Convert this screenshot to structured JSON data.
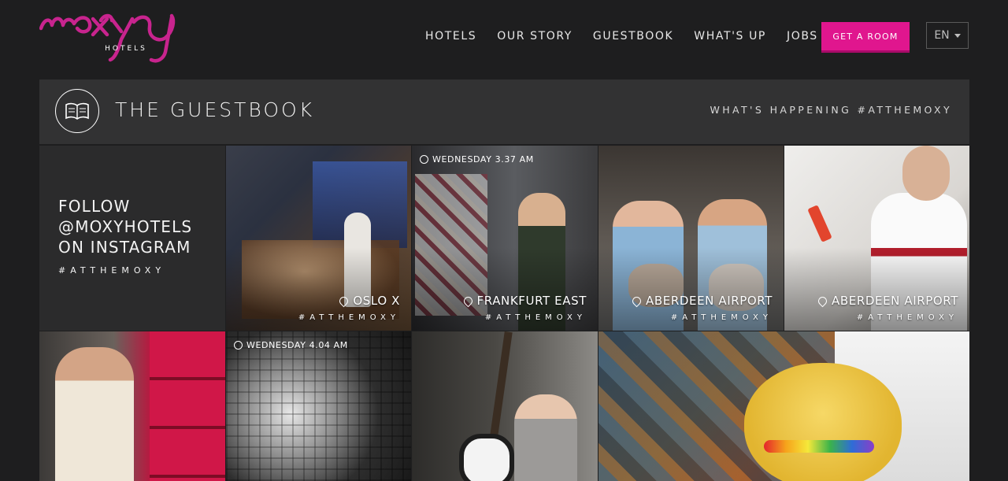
{
  "brand": {
    "name": "moxy",
    "sub": "HOTELS",
    "color": "#c8248e"
  },
  "nav": {
    "items": [
      "HOTELS",
      "OUR STORY",
      "GUESTBOOK",
      "WHAT'S UP",
      "JOBS"
    ],
    "cta_label": "GET A ROOM",
    "cta_color": "#e0168e",
    "lang": "EN"
  },
  "guestbook": {
    "title": "THE GUESTBOOK",
    "right_text": "WHAT'S HAPPENING #ATTHEMOXY"
  },
  "follow": {
    "line1": "FOLLOW",
    "line2": "@MOXYHOTELS",
    "line3": "ON INSTAGRAM",
    "tag": "#ATTHEMOXY"
  },
  "posts": [
    {
      "time": "",
      "location": "OSLO X",
      "tag": "#ATTHEMOXY",
      "icon": "party-photo"
    },
    {
      "time": "WEDNESDAY 3.37 AM",
      "location": "FRANKFURT EAST",
      "tag": "#ATTHEMOXY",
      "icon": "elevator-selfie"
    },
    {
      "time": "",
      "location": "ABERDEEN AIRPORT",
      "tag": "#ATTHEMOXY",
      "icon": "cats-photo"
    },
    {
      "time": "",
      "location": "ABERDEEN AIRPORT",
      "tag": "#ATTHEMOXY",
      "icon": "phone-photo"
    },
    {
      "time": "",
      "location": "",
      "tag": "",
      "icon": "lockers-photo"
    },
    {
      "time": "WEDNESDAY 4.04 AM",
      "location": "",
      "tag": "",
      "icon": "disco-ball-photo"
    },
    {
      "time": "",
      "location": "",
      "tag": "",
      "icon": "guitar-photo"
    },
    {
      "time": "",
      "location": "",
      "tag": "",
      "icon": "teddy-bear-photo"
    }
  ]
}
